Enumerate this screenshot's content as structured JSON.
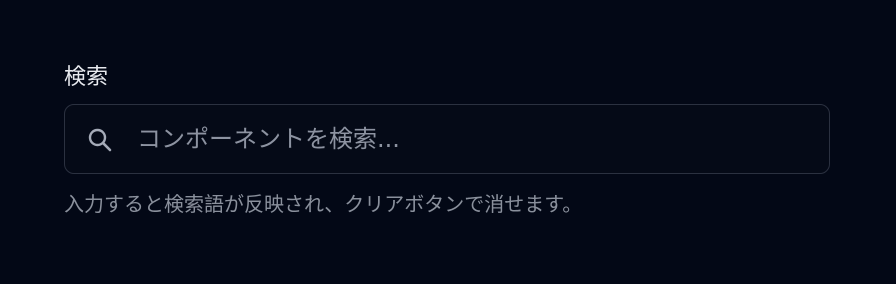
{
  "search": {
    "label": "検索",
    "placeholder": "コンポーネントを検索...",
    "value": "",
    "hint": "入力すると検索語が反映され、クリアボタンで消せます。"
  },
  "icons": {
    "search": "search-icon"
  },
  "colors": {
    "background": "#030816",
    "border": "#2b3140",
    "label": "#e7e9ee",
    "placeholder": "#8d93a1",
    "hint": "#8a909c"
  }
}
